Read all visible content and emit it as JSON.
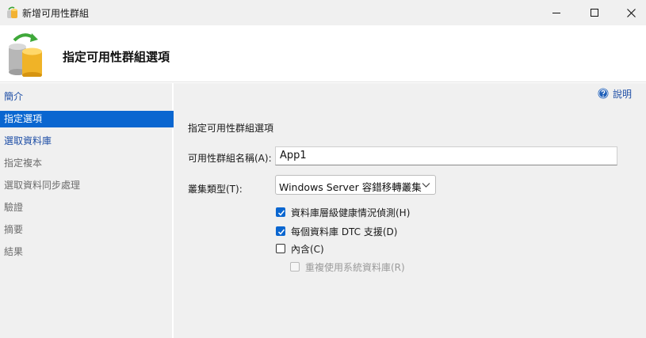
{
  "window": {
    "title": "新增可用性群組",
    "app_icon": "availability-group-icon",
    "controls": {
      "minimize": "minimize-icon",
      "maximize": "maximize-icon",
      "close": "close-icon"
    }
  },
  "header": {
    "icon": "database-sync-icon",
    "title": "指定可用性群組選項"
  },
  "sidebar": {
    "items": [
      {
        "label": "簡介",
        "state": "link"
      },
      {
        "label": "指定選項",
        "state": "selected"
      },
      {
        "label": "選取資料庫",
        "state": "link"
      },
      {
        "label": "指定複本",
        "state": "disabled"
      },
      {
        "label": "選取資料同步處理",
        "state": "disabled"
      },
      {
        "label": "驗證",
        "state": "disabled"
      },
      {
        "label": "摘要",
        "state": "disabled"
      },
      {
        "label": "結果",
        "state": "disabled"
      }
    ]
  },
  "main": {
    "help": {
      "icon": "help-icon",
      "label": "說明"
    },
    "section_title": "指定可用性群組選項",
    "name_field": {
      "label": "可用性群組名稱(A):",
      "value": "App1"
    },
    "cluster_type": {
      "label": "叢集類型(T):",
      "value": "Windows Server 容錯移轉叢集"
    },
    "options": [
      {
        "label": "資料庫層級健康情況偵測(H)",
        "checked": true,
        "enabled": true
      },
      {
        "label": "每個資料庫 DTC 支援(D)",
        "checked": true,
        "enabled": true
      },
      {
        "label": "內含(C)",
        "checked": false,
        "enabled": true
      },
      {
        "label": "重複使用系統資料庫(R)",
        "checked": false,
        "enabled": false
      }
    ]
  },
  "colors": {
    "accent": "#0a66d0",
    "link": "#1f4fa6",
    "panel": "#f0f0f0"
  }
}
